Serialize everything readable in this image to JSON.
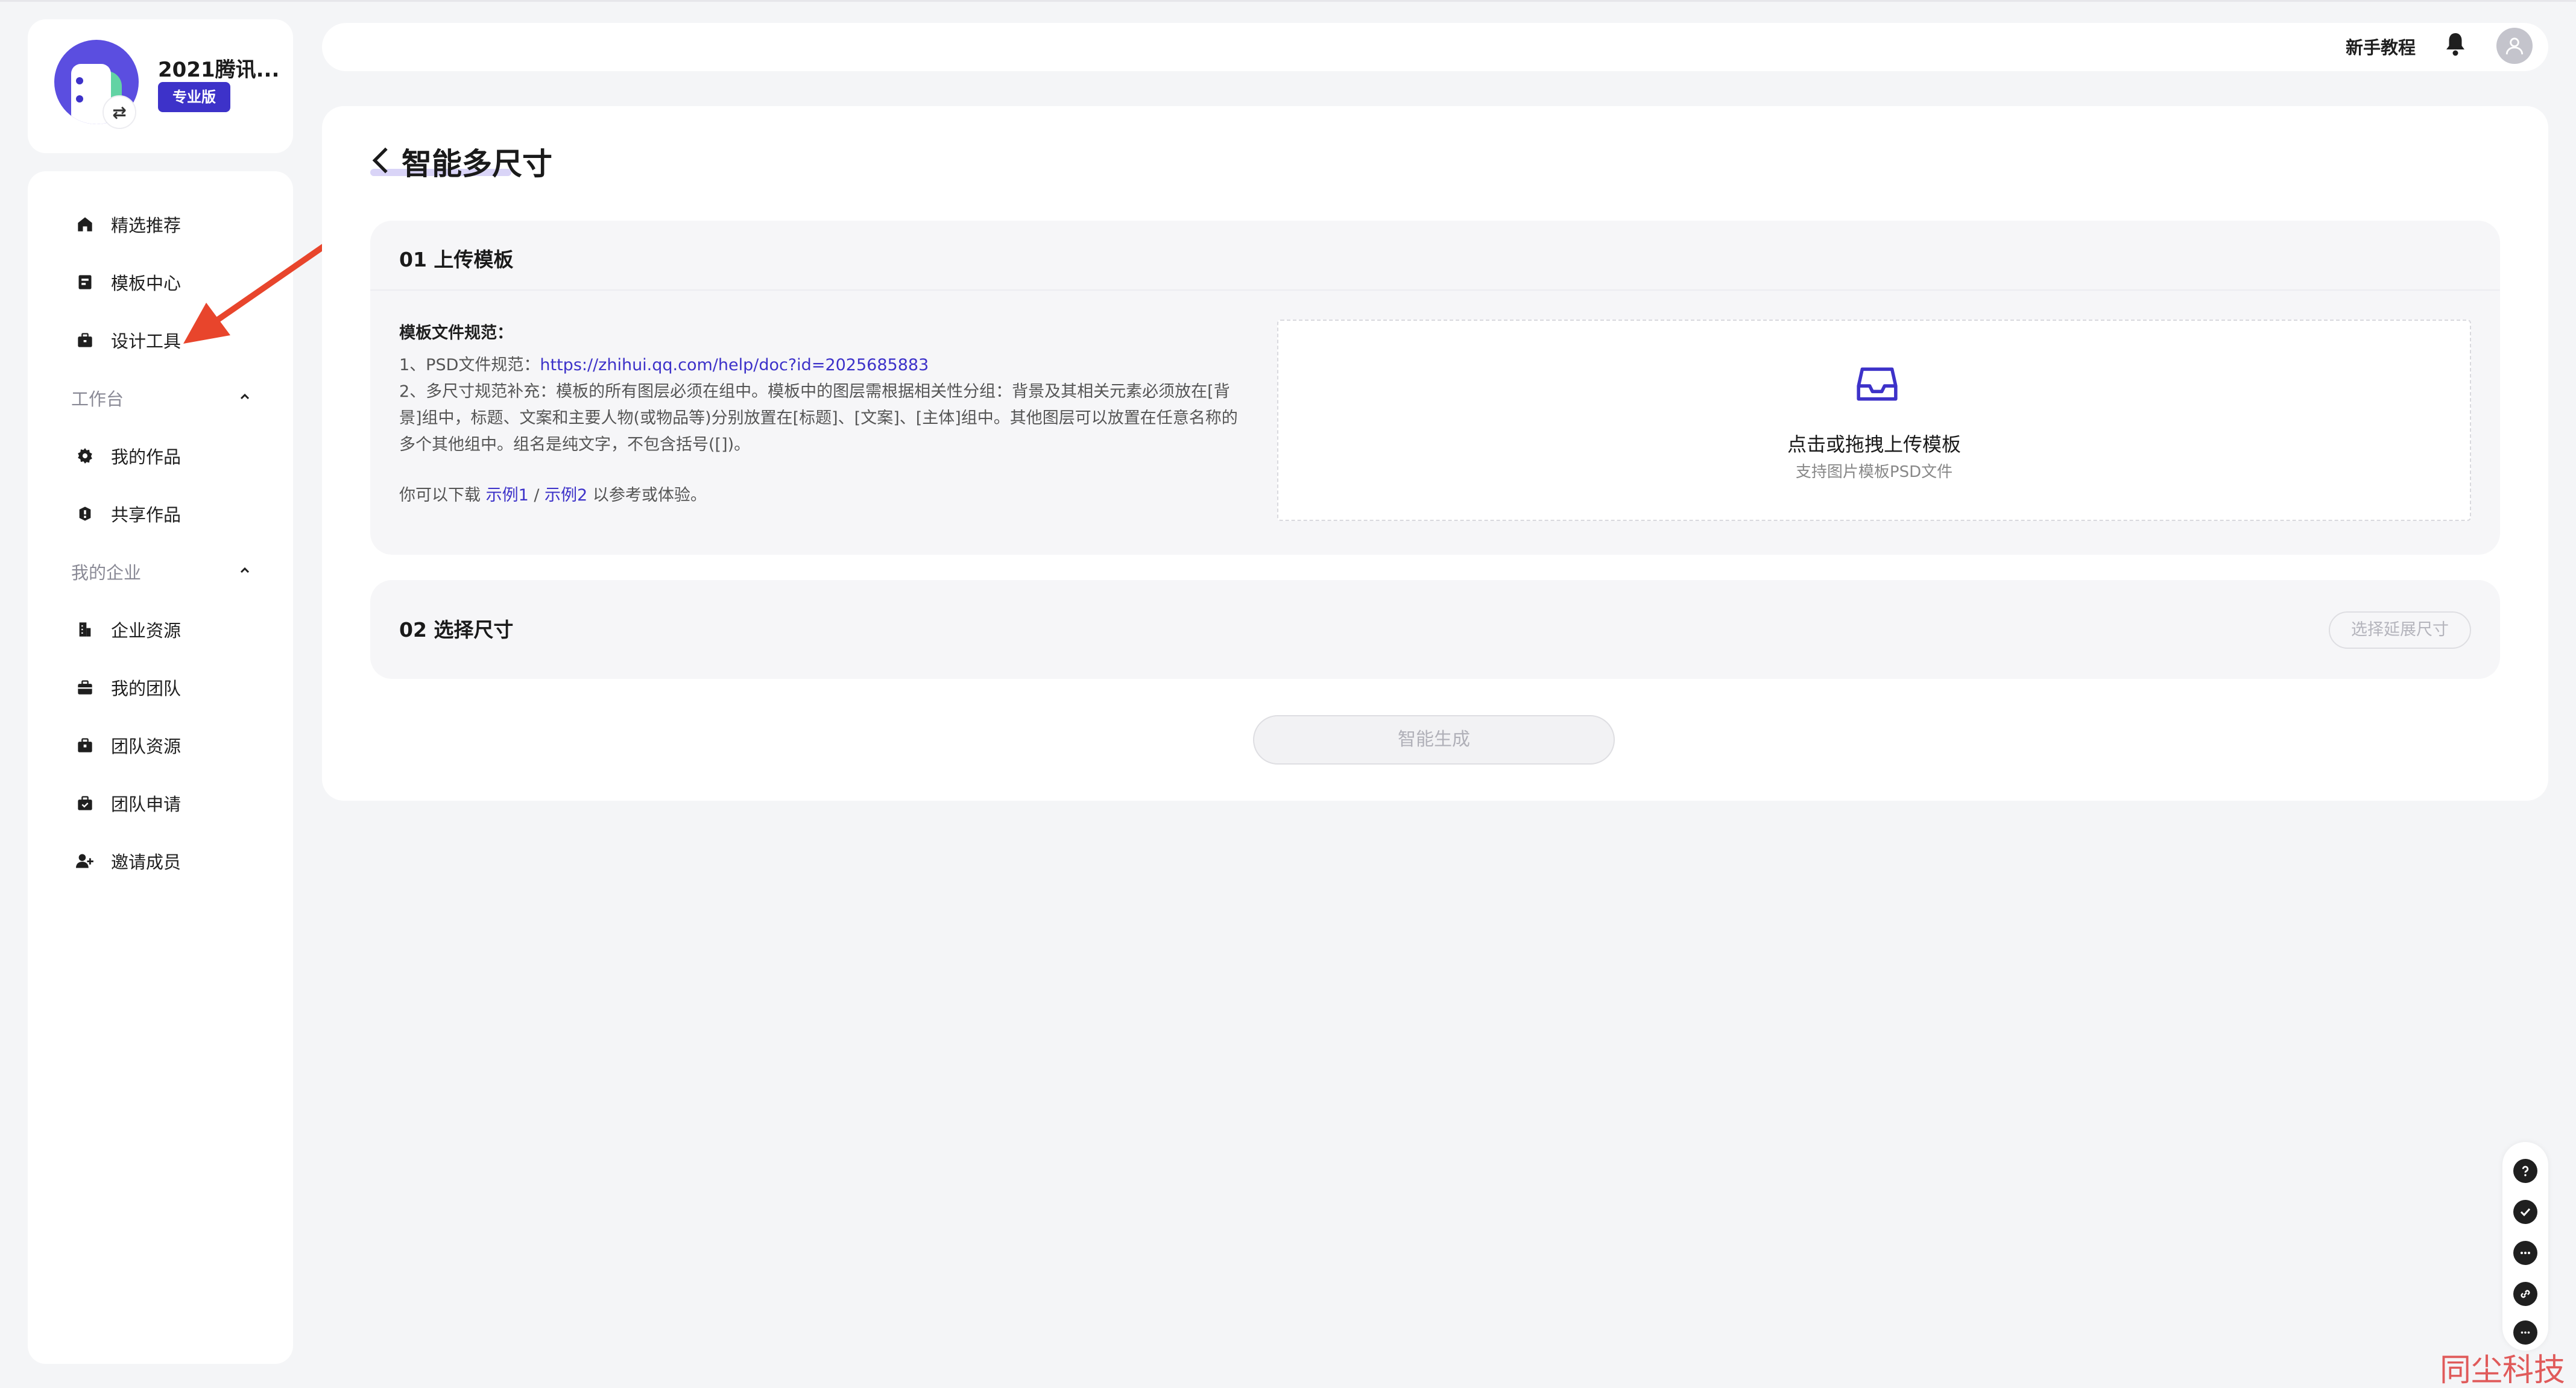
{
  "brand": {
    "name": "2021腾讯...",
    "badge": "专业版"
  },
  "sidebar": {
    "items": [
      {
        "label": "精选推荐",
        "icon": "home-icon"
      },
      {
        "label": "模板中心",
        "icon": "template-icon"
      },
      {
        "label": "设计工具",
        "icon": "toolbox-icon"
      }
    ],
    "group_workspace": {
      "label": "工作台",
      "items": [
        {
          "label": "我的作品",
          "icon": "gear-icon"
        },
        {
          "label": "共享作品",
          "icon": "share-icon"
        }
      ]
    },
    "group_enterprise": {
      "label": "我的企业",
      "items": [
        {
          "label": "企业资源",
          "icon": "building-icon"
        },
        {
          "label": "我的团队",
          "icon": "team-icon"
        },
        {
          "label": "团队资源",
          "icon": "briefcase-icon"
        },
        {
          "label": "团队申请",
          "icon": "folder-icon"
        },
        {
          "label": "邀请成员",
          "icon": "add-user-icon"
        }
      ]
    }
  },
  "header": {
    "tutorial": "新手教程"
  },
  "main": {
    "title": "智能多尺寸",
    "section1": {
      "title": "01 上传模板",
      "spec_title": "模板文件规范：",
      "spec_line1_prefix": "1、PSD文件规范：",
      "spec_line1_link": "https://zhihui.qq.com/help/doc?id=2025685883",
      "spec_line2": "2、多尺寸规范补充：模板的所有图层必须在组中。模板中的图层需根据相关性分组：背景及其相关元素必须放在[背景]组中，标题、文案和主要人物(或物品等)分别放置在[标题]、[文案]、[主体]组中。其他图层可以放置在任意名称的多个其他组中。组名是纯文字，不包含括号([])。",
      "download_prefix": "你可以下载 ",
      "example1": "示例1",
      "example_sep": " / ",
      "example2": "示例2",
      "download_suffix": " 以参考或体验。",
      "upload_title": "点击或拖拽上传模板",
      "upload_sub": "支持图片模板PSD文件"
    },
    "section2": {
      "title": "02 选择尺寸",
      "select_button": "选择延展尺寸"
    },
    "generate_button": "智能生成"
  },
  "watermark": "同尘科技",
  "colors": {
    "accent": "#3d32c9",
    "annotation_arrow": "#e8452c"
  }
}
